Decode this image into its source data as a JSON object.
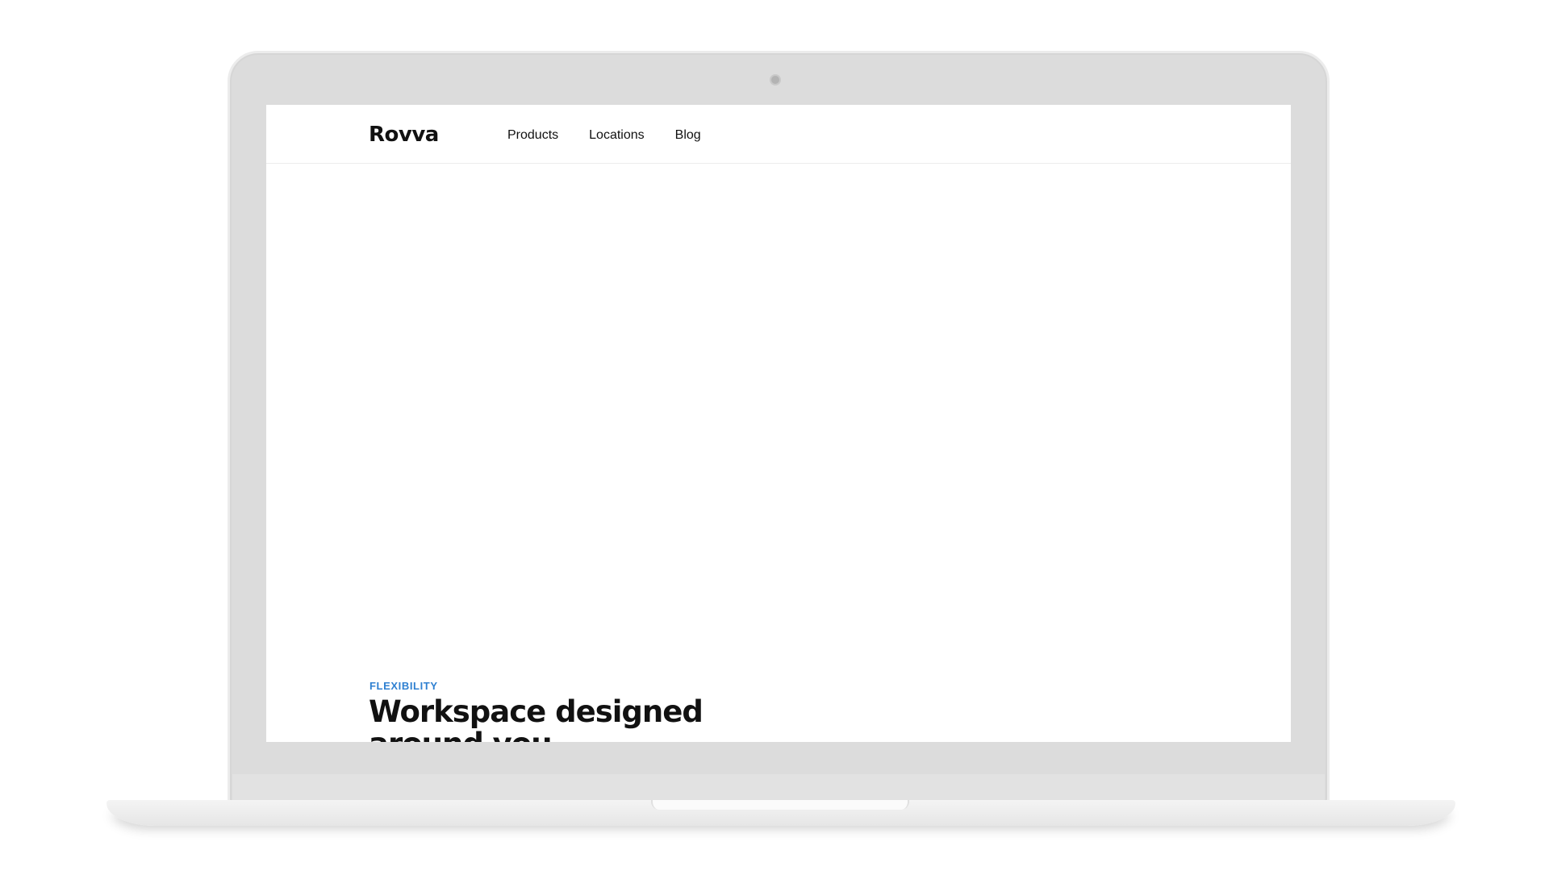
{
  "site": {
    "logo": "Rovva",
    "nav": [
      {
        "label": "Products"
      },
      {
        "label": "Locations"
      },
      {
        "label": "Blog"
      }
    ]
  },
  "hero": {
    "eyebrow": "FLEXIBILITY",
    "headline": "Workspace designed around you"
  },
  "colors": {
    "accent": "#2f80d1",
    "text": "#111111",
    "device": "#dcdcdc"
  }
}
